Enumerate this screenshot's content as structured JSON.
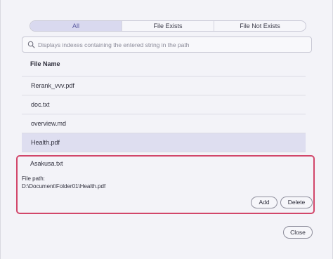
{
  "filter": {
    "tabs": [
      {
        "label": "All",
        "active": true
      },
      {
        "label": "File Exists",
        "active": false
      },
      {
        "label": "File Not Exists",
        "active": false
      }
    ]
  },
  "search": {
    "placeholder": "Displays indexes containing the entered string in the path",
    "value": ""
  },
  "table": {
    "header": "File Name",
    "rows": [
      {
        "name": "Rerank_vvv.pdf",
        "selected": false
      },
      {
        "name": "doc.txt",
        "selected": false
      },
      {
        "name": "overview.md",
        "selected": false
      },
      {
        "name": "Health.pdf",
        "selected": true
      },
      {
        "name": "Asakusa.txt",
        "selected": false
      }
    ]
  },
  "detail": {
    "path_label": "File path:",
    "path_value": "D:\\Document\\Folder01\\Health.pdf",
    "add_label": "Add",
    "delete_label": "Delete",
    "highlight_color": "#d2466a"
  },
  "footer": {
    "close_label": "Close"
  },
  "colors": {
    "accent": "#5a5aa0",
    "selected_row": "#dedef0"
  }
}
